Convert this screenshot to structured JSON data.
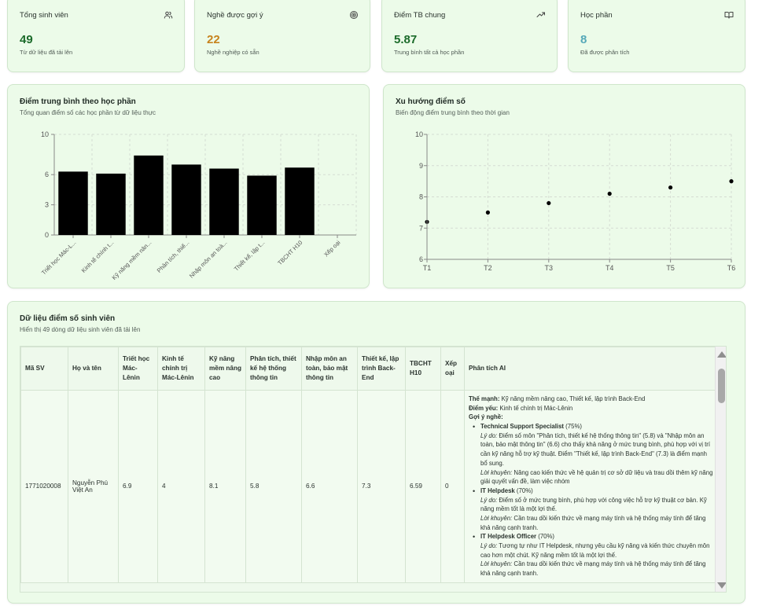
{
  "stats": [
    {
      "title": "Tổng sinh viên",
      "icon": "users-icon",
      "value": "49",
      "sub": "Từ dữ liệu đã tải lên",
      "color": "#1b6b2a"
    },
    {
      "title": "Nghề được gợi ý",
      "icon": "target-icon",
      "value": "22",
      "sub": "Nghề nghiệp có sẵn",
      "color": "#c7831d"
    },
    {
      "title": "Điểm TB chung",
      "icon": "trending-up-icon",
      "value": "5.87",
      "sub": "Trung bình tất cả học phần",
      "color": "#1b6b2a"
    },
    {
      "title": "Học phần",
      "icon": "book-open-icon",
      "value": "8",
      "sub": "Đã được phân tích",
      "color": "#55a8b8"
    }
  ],
  "bar_panel": {
    "title": "Điểm trung bình theo học phần",
    "sub": "Tổng quan điểm số các học phần từ dữ liệu thực"
  },
  "scatter_panel": {
    "title": "Xu hướng điểm số",
    "sub": "Biến động điểm trung bình theo thời gian"
  },
  "chart_data": [
    {
      "type": "bar",
      "categories": [
        "Triết học Mác-L...",
        "Kinh tế chính t...",
        "Kỹ năng mềm nân...",
        "Phân tích, thiế...",
        "Nhập môn an toà...",
        "Thiết kế, lập t...",
        "TBCHT H10",
        "Xếp oại"
      ],
      "values": [
        6.3,
        6.1,
        7.9,
        7.0,
        6.6,
        5.9,
        6.7,
        0
      ],
      "yticks": [
        0,
        3,
        6,
        10
      ],
      "ylim": [
        0,
        10
      ],
      "bar_color": "#000000",
      "grid": true
    },
    {
      "type": "scatter",
      "x": [
        "T1",
        "T2",
        "T3",
        "T4",
        "T5",
        "T6"
      ],
      "y": [
        7.2,
        7.5,
        7.8,
        8.1,
        8.3,
        8.5
      ],
      "yticks": [
        6,
        7,
        8,
        9,
        10
      ],
      "ylim": [
        6,
        10
      ],
      "grid": true
    }
  ],
  "table": {
    "title": "Dữ liệu điểm số sinh viên",
    "sub": "Hiển thị 49 dòng dữ liệu sinh viên đã tải lên",
    "headers": [
      "Mã SV",
      "Họ và tên",
      "Triết học Mác-Lênin",
      "Kinh tế chính trị Mác-Lênin",
      "Kỹ năng mềm nâng cao",
      "Phân tích, thiết kế hệ thống thông tin",
      "Nhập môn an toàn, bảo mật thông tin",
      "Thiết kế, lập trình Back-End",
      "TBCHT H10",
      "Xếp oại",
      "Phân tích AI"
    ],
    "row": {
      "id": "1771020008",
      "name": "Nguyễn Phú Việt An",
      "c1": "6.9",
      "c2": "4",
      "c3": "8.1",
      "c4": "5.8",
      "c5": "6.6",
      "c6": "7.3",
      "c7": "6.59",
      "c8": "0",
      "ai": {
        "strength_label": "Thế mạnh:",
        "strength": " Kỹ năng mềm nâng cao, Thiết kế, lập trình Back-End",
        "weak_label": "Điểm yếu:",
        "weak": " Kinh tế chính trị Mác-Lênin",
        "suggest_label": "Gợi ý nghề:",
        "reason_label": "Lý do:",
        "advice_label": "Lời khuyên:",
        "jobs": [
          {
            "name": "Technical Support Specialist",
            "pct": " (75%)",
            "reason": " Điểm số môn \"Phân tích, thiết kế hệ thống thông tin\" (5.8) và \"Nhập môn an toàn, bảo mật thông tin\" (6.6) cho thấy khả năng ở mức trung bình, phù hợp với vị trí cần kỹ năng hỗ trợ kỹ thuật. Điểm \"Thiết kế, lập trình Back-End\" (7.3) là điểm mạnh bổ sung.",
            "advice": " Nâng cao kiến thức về hệ quản trị cơ sở dữ liệu và trau dồi thêm kỹ năng giải quyết vấn đề, làm việc nhóm"
          },
          {
            "name": "IT Helpdesk",
            "pct": " (70%)",
            "reason": " Điểm số ở mức trung bình, phù hợp với công việc hỗ trợ kỹ thuật cơ bản. Kỹ năng mềm tốt là một lợi thế.",
            "advice": " Cần trau dồi kiến thức về mạng máy tính và hệ thống máy tính để tăng khả năng cạnh tranh."
          },
          {
            "name": "IT Helpdesk Officer",
            "pct": " (70%)",
            "reason": " Tương tự như IT Helpdesk, nhưng yêu cầu kỹ năng và kiến thức chuyên môn cao hơn một chút. Kỹ năng mềm tốt là một lợi thế.",
            "advice": " Cần trau dồi kiến thức về mạng máy tính và hệ thống máy tính để tăng khả năng cạnh tranh."
          }
        ]
      }
    }
  }
}
